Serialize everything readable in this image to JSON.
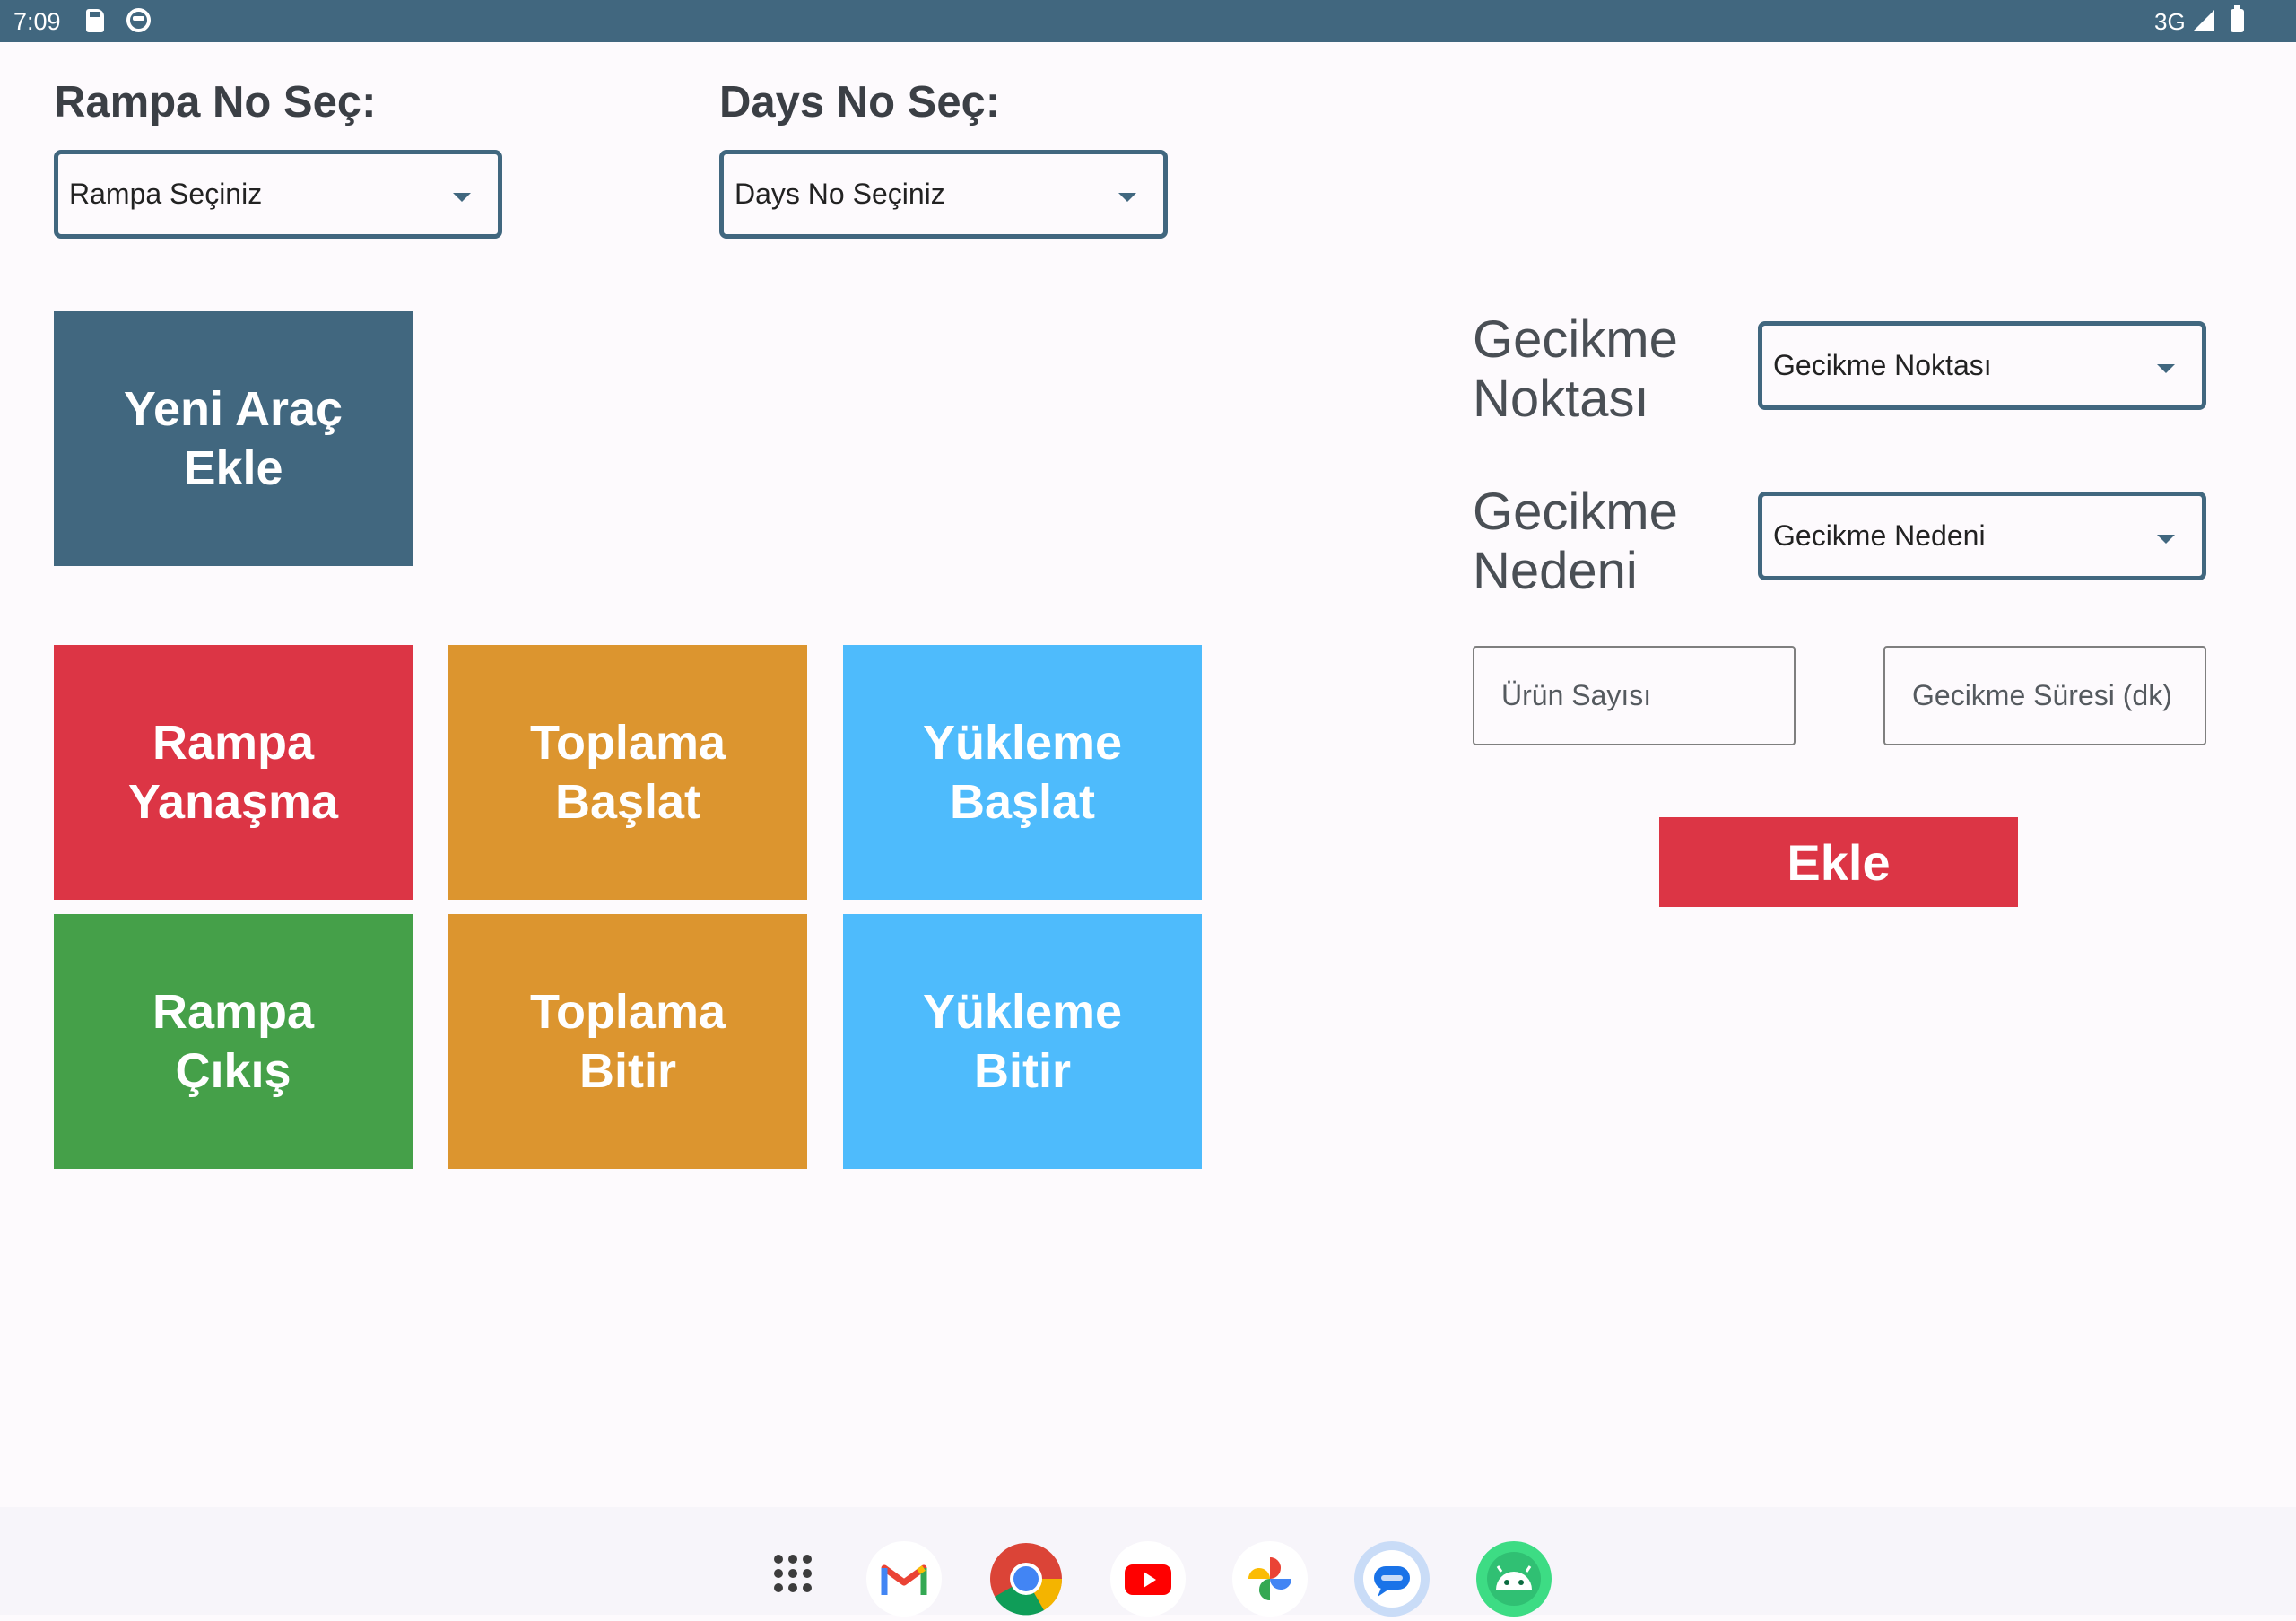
{
  "status_bar": {
    "time": "7:09",
    "network": "3G",
    "icons": [
      "sd-card-icon",
      "face-icon",
      "signal-icon",
      "battery-icon"
    ]
  },
  "ramp_select": {
    "label": "Rampa No Seç:",
    "value": "Rampa Seçiniz"
  },
  "days_select": {
    "label": "Days No Seç:",
    "value": "Days No Seçiniz"
  },
  "new_vehicle_button": {
    "label": "Yeni Araç\nEkle",
    "color": "#41677f"
  },
  "action_tiles": [
    {
      "label": "Rampa\nYanaşma",
      "color": "#dc3545"
    },
    {
      "label": "Toplama\nBaşlat",
      "color": "#dc952f"
    },
    {
      "label": "Yükleme\nBaşlat",
      "color": "#4ebbfc"
    },
    {
      "label": "Rampa\nÇıkış",
      "color": "#45a049"
    },
    {
      "label": "Toplama\nBitir",
      "color": "#dc952f"
    },
    {
      "label": "Yükleme\nBitir",
      "color": "#4ebbfc"
    }
  ],
  "delay_point": {
    "label": "Gecikme\nNoktası",
    "value": "Gecikme Noktası"
  },
  "delay_reason": {
    "label": "Gecikme\nNedeni",
    "value": "Gecikme Nedeni"
  },
  "product_count": {
    "placeholder": "Ürün Sayısı"
  },
  "delay_duration": {
    "placeholder": "Gecikme Süresi (dk)"
  },
  "add_button": {
    "label": "Ekle",
    "color": "#dc3545"
  },
  "dock": {
    "apps": [
      "app-drawer-icon",
      "gmail-icon",
      "chrome-icon",
      "youtube-icon",
      "photos-icon",
      "messages-icon",
      "android-icon"
    ]
  }
}
